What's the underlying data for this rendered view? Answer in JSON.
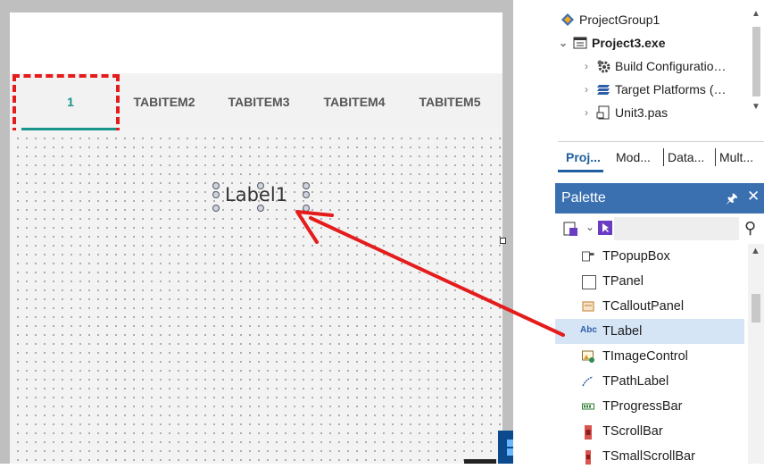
{
  "designer": {
    "tabs": [
      {
        "label": "1",
        "active": true
      },
      {
        "label": "TABITEM2",
        "active": false
      },
      {
        "label": "TABITEM3",
        "active": false
      },
      {
        "label": "TABITEM4",
        "active": false
      },
      {
        "label": "TABITEM5",
        "active": false
      }
    ],
    "label_component": "Label1",
    "accent_color": "#17958a",
    "annotation_color": "#e41c1c"
  },
  "project_tree": {
    "items": [
      {
        "label": "ProjectGroup1",
        "icon": "project-group-icon"
      },
      {
        "label": "Project3.exe",
        "icon": "exe-project-icon"
      },
      {
        "label": "Build Configuratio…",
        "icon": "gear-icon"
      },
      {
        "label": "Target Platforms (…",
        "icon": "platforms-icon"
      },
      {
        "label": "Unit3.pas",
        "icon": "unit-file-icon"
      }
    ]
  },
  "project_tabs": [
    "Proj...",
    "Mod...",
    "Data...",
    "Mult..."
  ],
  "palette": {
    "title": "Palette",
    "pin": "🖈",
    "close": "✕",
    "items": [
      {
        "label": "TPopupBox",
        "icon": "popupbox-icon",
        "selected": false
      },
      {
        "label": "TPanel",
        "icon": "panel-icon",
        "selected": false
      },
      {
        "label": "TCalloutPanel",
        "icon": "callout-panel-icon",
        "selected": false
      },
      {
        "label": "TLabel",
        "icon": "label-icon",
        "icon_text": "Abc",
        "selected": true
      },
      {
        "label": "TImageControl",
        "icon": "image-control-icon",
        "selected": false
      },
      {
        "label": "TPathLabel",
        "icon": "path-label-icon",
        "selected": false
      },
      {
        "label": "TProgressBar",
        "icon": "progressbar-icon",
        "selected": false
      },
      {
        "label": "TScrollBar",
        "icon": "scrollbar-icon",
        "selected": false
      },
      {
        "label": "TSmallScrollBar",
        "icon": "small-scrollbar-icon",
        "selected": false
      }
    ],
    "header_color": "#3a6fb0",
    "selection_color": "#d5e5f6"
  }
}
